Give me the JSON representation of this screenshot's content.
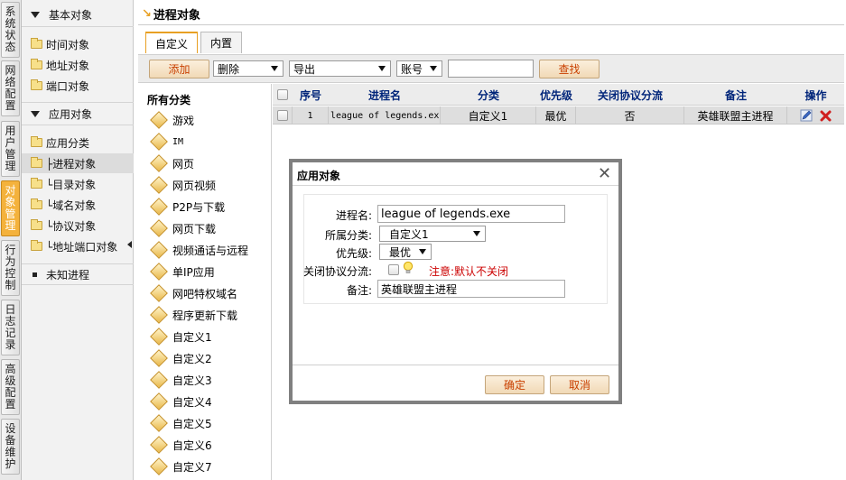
{
  "vtabs": [
    {
      "chars": [
        "系",
        "统",
        "状",
        "态"
      ]
    },
    {
      "chars": [
        "网",
        "络",
        "配",
        "置"
      ]
    },
    {
      "chars": [
        "用",
        "户",
        "管",
        "理"
      ]
    },
    {
      "chars": [
        "对",
        "象",
        "管",
        "理"
      ]
    },
    {
      "chars": [
        "行",
        "为",
        "控",
        "制"
      ]
    },
    {
      "chars": [
        "日",
        "志",
        "记",
        "录"
      ]
    },
    {
      "chars": [
        "高",
        "级",
        "配",
        "置"
      ]
    },
    {
      "chars": [
        "设",
        "备",
        "维",
        "护"
      ]
    }
  ],
  "tree": {
    "basic_header": "基本对象",
    "basic_items": [
      "时间对象",
      "地址对象",
      "端口对象"
    ],
    "app_header": "应用对象",
    "app_items": [
      "应用分类",
      "├进程对象",
      "└目录对象",
      "└域名对象",
      "└协议对象",
      "└地址端口对象"
    ],
    "unknown": "未知进程"
  },
  "main": {
    "title": "进程对象",
    "tabs": [
      "自定义",
      "内置"
    ],
    "toolbar": {
      "add": "添加",
      "delete": "删除",
      "export": "导出",
      "account": "账号",
      "search_value": "",
      "search": "查找"
    }
  },
  "categories": {
    "title": "所有分类",
    "items": [
      "游戏",
      "IM",
      "网页",
      "网页视频",
      "P2P与下载",
      "网页下载",
      "视频通话与远程",
      "单IP应用",
      "网吧特权域名",
      "程序更新下载",
      "自定义1",
      "自定义2",
      "自定义3",
      "自定义4",
      "自定义5",
      "自定义6",
      "自定义7"
    ]
  },
  "table": {
    "headers": {
      "seq": "序号",
      "name": "进程名",
      "category": "分类",
      "priority": "优先级",
      "close_flow": "关闭协议分流",
      "note": "备注",
      "action": "操作"
    },
    "rows": [
      {
        "seq": "1",
        "name": "league of legends.ex",
        "category": "自定义1",
        "priority": "最优",
        "close_flow": "否",
        "note": "英雄联盟主进程"
      }
    ]
  },
  "dialog": {
    "title": "应用对象",
    "close": "✕",
    "labels": {
      "name": "进程名:",
      "category": "所属分类:",
      "priority": "优先级:",
      "close_flow": "关闭协议分流:",
      "note": "备注:"
    },
    "values": {
      "name": "league of legends.exe",
      "category": "自定义1",
      "priority": "最优",
      "note": "英雄联盟主进程"
    },
    "hint": "注意:默认不关闭",
    "ok": "确定",
    "cancel": "取消"
  },
  "icons": {
    "edit": "pencil-icon",
    "delete": "delete-icon",
    "hint": "lightbulb-icon",
    "folder": "folder-icon",
    "category": "diamond-icon"
  },
  "colors": {
    "accent": "#e8a023",
    "active_tab": "#f4b23c",
    "header_text": "#00257a",
    "button_text": "#c94000",
    "hint_text": "#cc0000"
  }
}
